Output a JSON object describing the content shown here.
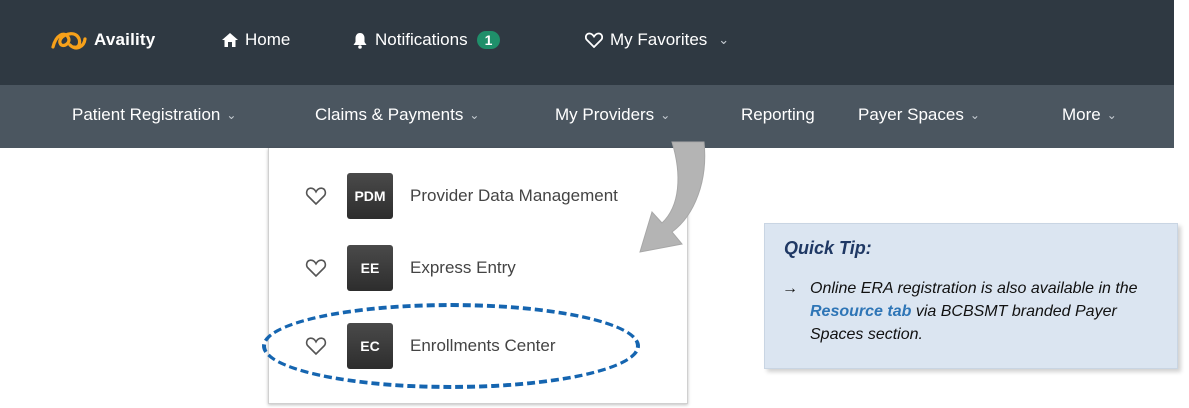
{
  "topbar": {
    "logo_text": "Availity",
    "home": "Home",
    "notifications": "Notifications",
    "notifications_count": "1",
    "favorites": "My Favorites"
  },
  "nav": {
    "items": [
      {
        "label": "Patient Registration",
        "has_menu": true
      },
      {
        "label": "Claims & Payments",
        "has_menu": true
      },
      {
        "label": "My Providers",
        "has_menu": true
      },
      {
        "label": "Reporting",
        "has_menu": false
      },
      {
        "label": "Payer Spaces",
        "has_menu": true
      },
      {
        "label": "More",
        "has_menu": true
      }
    ]
  },
  "dropdown": {
    "items": [
      {
        "code": "PDM",
        "label": "Provider Data Management"
      },
      {
        "code": "EE",
        "label": "Express Entry"
      },
      {
        "code": "EC",
        "label": "Enrollments Center"
      }
    ]
  },
  "tip": {
    "title": "Quick Tip:",
    "arrow": "→",
    "text_before": "Online ERA registration is also available in the ",
    "link": "Resource tab",
    "text_after": " via BCBSMT branded Payer Spaces section."
  },
  "colors": {
    "topbar": "#2f3942",
    "navbar": "#4b5660",
    "badge": "#1f8f6a",
    "highlight": "#1565b0",
    "tip_bg": "#dbe5f1",
    "tip_title": "#1f3864",
    "link": "#2e75b6"
  }
}
